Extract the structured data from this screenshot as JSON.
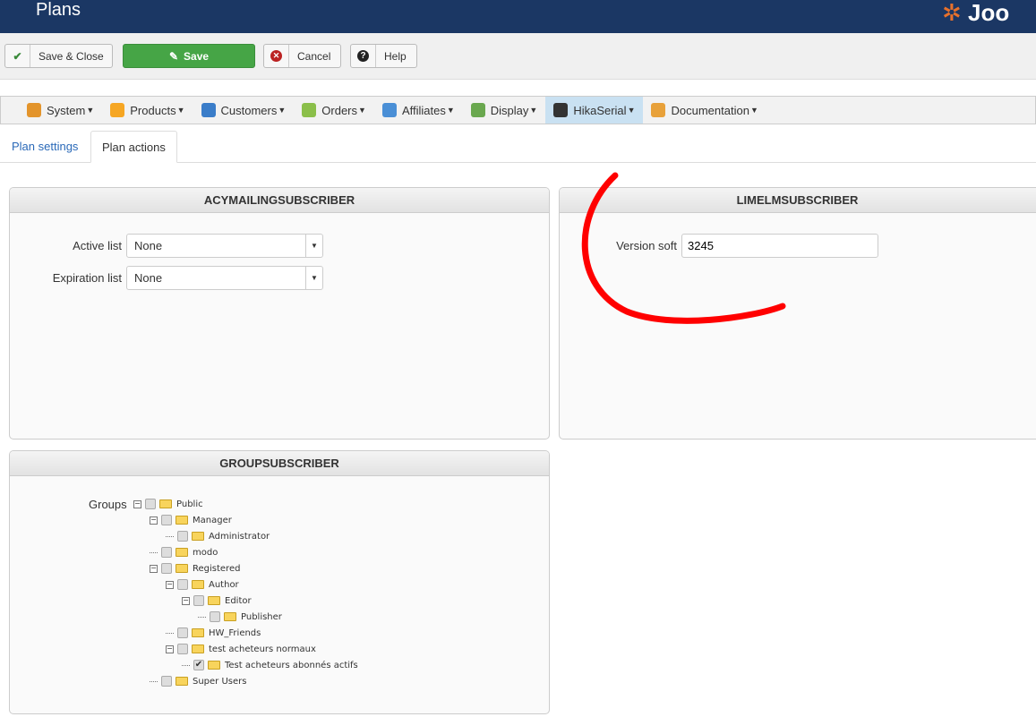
{
  "header": {
    "title": "Plans",
    "logo": "Joo"
  },
  "toolbar": {
    "save_close": "Save & Close",
    "save": "Save",
    "cancel": "Cancel",
    "help": "Help"
  },
  "menu": [
    {
      "label": "System",
      "color": "#e3942b"
    },
    {
      "label": "Products",
      "color": "#f6a623"
    },
    {
      "label": "Customers",
      "color": "#3a7dc9"
    },
    {
      "label": "Orders",
      "color": "#8bbf4a"
    },
    {
      "label": "Affiliates",
      "color": "#4a8fd6"
    },
    {
      "label": "Display",
      "color": "#6aa84f"
    },
    {
      "label": "HikaSerial",
      "color": "#333333"
    },
    {
      "label": "Documentation",
      "color": "#e8a13a"
    }
  ],
  "tabs": [
    "Plan settings",
    "Plan actions"
  ],
  "acy": {
    "title": "ACYMAILINGSUBSCRIBER",
    "active_label": "Active list",
    "active_value": "None",
    "exp_label": "Expiration list",
    "exp_value": "None"
  },
  "lime": {
    "title": "LIMELMSUBSCRIBER",
    "version_label": "Version soft",
    "version_value": "3245"
  },
  "group": {
    "title": "GROUPSUBSCRIBER",
    "label": "Groups",
    "tree": [
      {
        "label": "Public",
        "level": 0,
        "exp": true,
        "checked": false
      },
      {
        "label": "Manager",
        "level": 1,
        "exp": true,
        "checked": false
      },
      {
        "label": "Administrator",
        "level": 2,
        "exp": false,
        "checked": false
      },
      {
        "label": "modo",
        "level": 1,
        "exp": false,
        "checked": false
      },
      {
        "label": "Registered",
        "level": 1,
        "exp": true,
        "checked": false
      },
      {
        "label": "Author",
        "level": 2,
        "exp": true,
        "checked": false
      },
      {
        "label": "Editor",
        "level": 3,
        "exp": true,
        "checked": false
      },
      {
        "label": "Publisher",
        "level": 4,
        "exp": false,
        "checked": false
      },
      {
        "label": "HW_Friends",
        "level": 2,
        "exp": false,
        "checked": false
      },
      {
        "label": "test acheteurs normaux",
        "level": 2,
        "exp": true,
        "checked": false
      },
      {
        "label": "Test acheteurs abonnés actifs",
        "level": 3,
        "exp": false,
        "checked": true
      },
      {
        "label": "Super Users",
        "level": 1,
        "exp": false,
        "checked": false
      }
    ]
  }
}
